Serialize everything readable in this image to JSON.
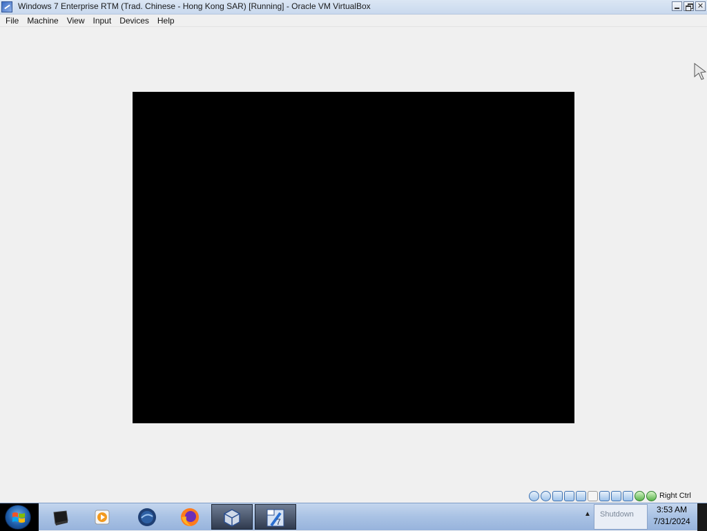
{
  "window": {
    "title": "Windows 7 Enterprise RTM (Trad. Chinese - Hong Kong SAR) [Running] - Oracle VM VirtualBox",
    "close_glyph": "✕"
  },
  "menu": [
    "File",
    "Machine",
    "View",
    "Input",
    "Devices",
    "Help"
  ],
  "statusbar": {
    "icons": [
      "hard-disk-icon",
      "optical-drive-icon",
      "audio-icon",
      "network-icon",
      "usb-icon",
      "shared-folders-icon",
      "display-icon",
      "video-capture-icon",
      "snapshot-icon",
      "cpu-icon",
      "mouse-integration-icon",
      "keyboard-icon"
    ],
    "host_key": "Right Ctrl"
  },
  "taskbar": {
    "apps": [
      "terminal-icon",
      "media-player-icon",
      "thunderbird-icon",
      "firefox-icon",
      "virtualbox-icon",
      "win7-vm-icon"
    ],
    "tray_text": "Shutdown",
    "time": "3:53 AM",
    "date": "7/31/2024"
  },
  "colors": {
    "vm_screen": "#000000",
    "window_bg": "#f0f0f0",
    "taskbar": "#a9c2e4"
  }
}
